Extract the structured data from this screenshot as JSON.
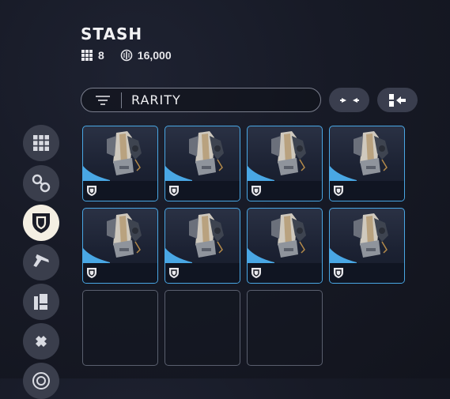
{
  "header": {
    "title": "STASH",
    "slot_count": "8",
    "currency": "16,000"
  },
  "filter": {
    "label": "RARITY"
  },
  "colors": {
    "accent": "#49a7e4",
    "active_tab": "#f4efe3",
    "panel": "#3a3e4c"
  },
  "sidebar": {
    "items": [
      {
        "name": "all-items",
        "icon": "grid-icon",
        "active": false
      },
      {
        "name": "attachments",
        "icon": "chain-icon",
        "active": false
      },
      {
        "name": "armor",
        "icon": "shield-icon",
        "active": true
      },
      {
        "name": "weapons",
        "icon": "pistol-icon",
        "active": false
      },
      {
        "name": "consumables",
        "icon": "items-icon",
        "active": false
      },
      {
        "name": "materials",
        "icon": "puzzle-icon",
        "active": false
      },
      {
        "name": "more",
        "icon": "target-icon",
        "active": false
      }
    ]
  },
  "toolbar": {
    "buttons": [
      {
        "icon": "merge-icon"
      },
      {
        "icon": "collapse-icon"
      }
    ]
  },
  "grid": {
    "slots": [
      {
        "item": "armor-rig",
        "rarity": "shield-icon"
      },
      {
        "item": "armor-rig",
        "rarity": "shield-icon"
      },
      {
        "item": "armor-rig",
        "rarity": "shield-icon"
      },
      {
        "item": "armor-rig",
        "rarity": "shield-icon"
      },
      {
        "item": "armor-rig",
        "rarity": "shield-icon"
      },
      {
        "item": "armor-rig",
        "rarity": "shield-icon"
      },
      {
        "item": "armor-rig",
        "rarity": "shield-icon"
      },
      {
        "item": "armor-rig",
        "rarity": "shield-icon"
      },
      {
        "item": null
      },
      {
        "item": null
      },
      {
        "item": null
      }
    ]
  }
}
